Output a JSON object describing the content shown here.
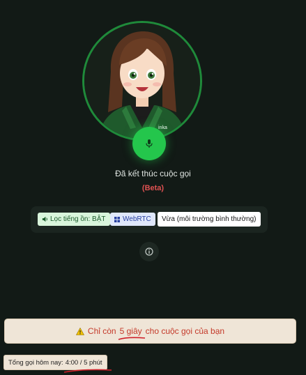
{
  "avatar": {
    "icon": "woman-avatar-icon",
    "jacket_text": "inka"
  },
  "call": {
    "mic_icon": "microphone-icon",
    "status": "Đã kết thúc cuộc gọi",
    "beta": "(Beta)"
  },
  "toolbar": {
    "noise_filter_label": "Lọc tiếng ồn: BẬT",
    "noise_icon": "speaker-icon",
    "webrtc_label": "WebRTC",
    "webrtc_icon": "grid-icon",
    "mode_selected": "Vừa (môi trường bình thường)",
    "mode_icon": "chevron-down-icon"
  },
  "info_icon": "info-icon",
  "warning": {
    "icon": "warning-icon",
    "text_prefix": "Chỉ còn",
    "text_highlight": "5 giây",
    "text_suffix": "cho cuộc gọi của bạn"
  },
  "usage": {
    "label": "Tổng gọi hôm nay:",
    "value": "4:00 / 5 phút"
  },
  "colors": {
    "background": "#121a16",
    "accent_green": "#24c64c",
    "ring_green": "#1f8a3a",
    "beta_red": "#e05252",
    "warning_text": "#c43a2a",
    "underline_red": "#d0202a"
  }
}
